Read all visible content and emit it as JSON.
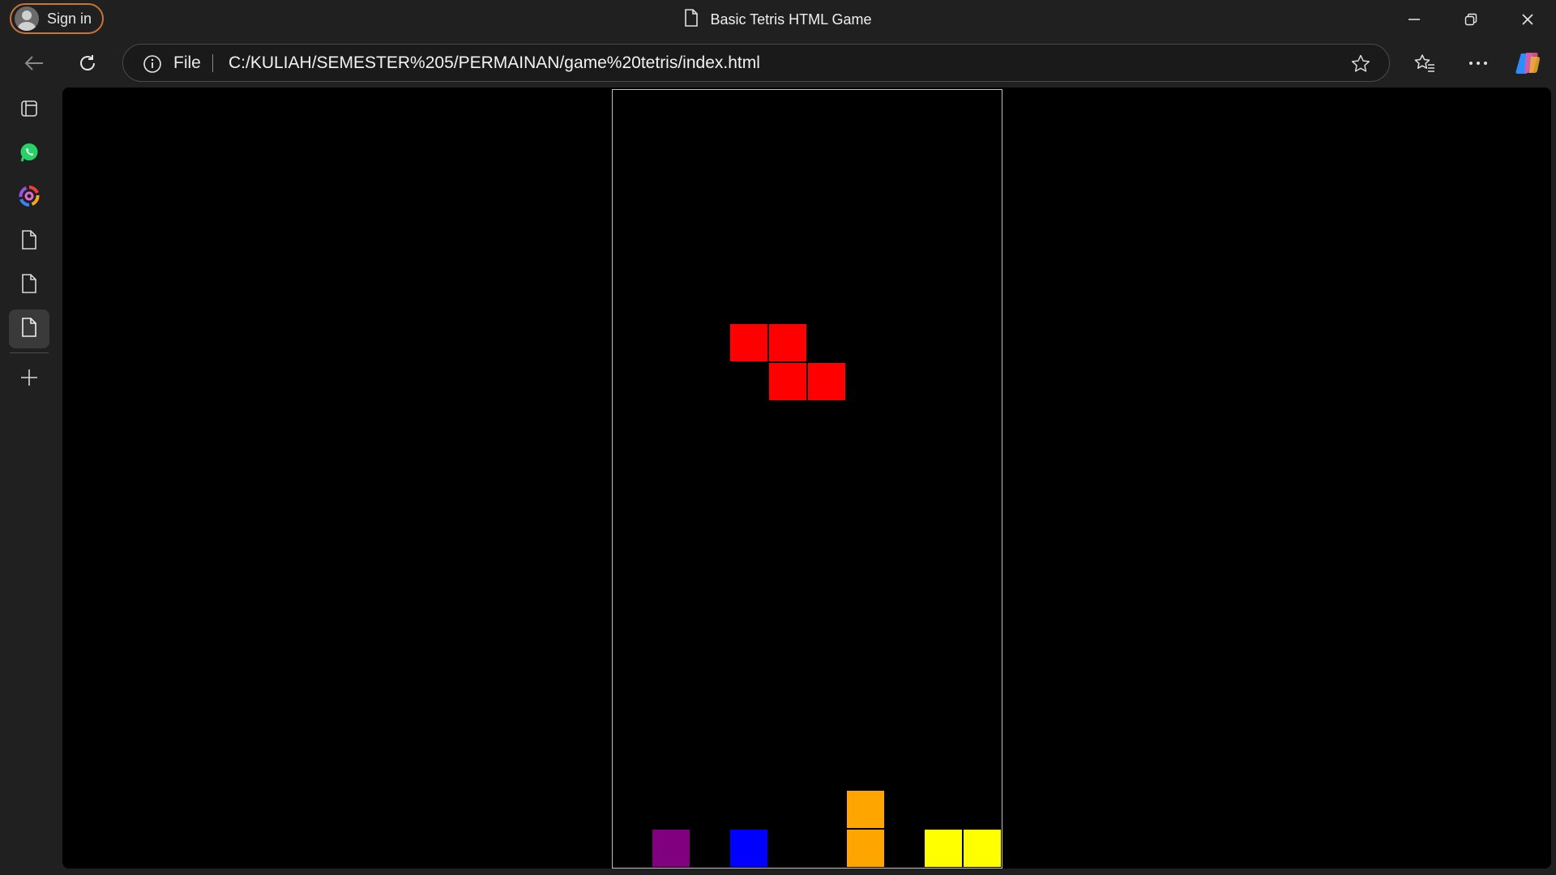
{
  "window": {
    "title": "Basic Tetris HTML Game",
    "sign_in_label": "Sign in"
  },
  "address_bar": {
    "scheme_label": "File",
    "url": "C:/KULIAH/SEMESTER%205/PERMAINAN/game%20tetris/index.html"
  },
  "icons": {
    "back": "arrow-left-icon",
    "refresh": "refresh-icon",
    "info": "info-icon",
    "favorite": "star-icon",
    "favorites_list": "favorites-icon",
    "more": "more-icon",
    "copilot": "copilot-icon",
    "minimize": "minimize-icon",
    "restore": "restore-icon",
    "close": "close-icon"
  },
  "sidebar": {
    "items": [
      {
        "name": "sidebar-tab-view",
        "icon": "tab-view-icon"
      },
      {
        "name": "sidebar-whatsapp",
        "icon": "whatsapp-icon"
      },
      {
        "name": "sidebar-swirl-app",
        "icon": "swirl-app-icon"
      },
      {
        "name": "sidebar-page-1",
        "icon": "page-icon"
      },
      {
        "name": "sidebar-page-2",
        "icon": "page-icon"
      },
      {
        "name": "sidebar-page-3",
        "icon": "page-icon",
        "active": true
      }
    ],
    "add_icon": "plus-icon"
  },
  "game": {
    "columns": 10,
    "rows": 20,
    "colors": {
      "red": "#ff0000",
      "purple": "#800080",
      "blue": "#0000ff",
      "orange": "#ffa500",
      "yellow": "#ffff00"
    },
    "active_piece": {
      "shape": "Z",
      "color": "red",
      "cells": [
        [
          3,
          6
        ],
        [
          4,
          6
        ],
        [
          4,
          7
        ],
        [
          5,
          7
        ]
      ]
    },
    "settled_cells": [
      {
        "col": 1,
        "row": 19,
        "color": "purple"
      },
      {
        "col": 3,
        "row": 19,
        "color": "blue"
      },
      {
        "col": 6,
        "row": 18,
        "color": "orange"
      },
      {
        "col": 6,
        "row": 19,
        "color": "orange"
      },
      {
        "col": 8,
        "row": 19,
        "color": "yellow"
      },
      {
        "col": 9,
        "row": 19,
        "color": "yellow"
      }
    ]
  }
}
